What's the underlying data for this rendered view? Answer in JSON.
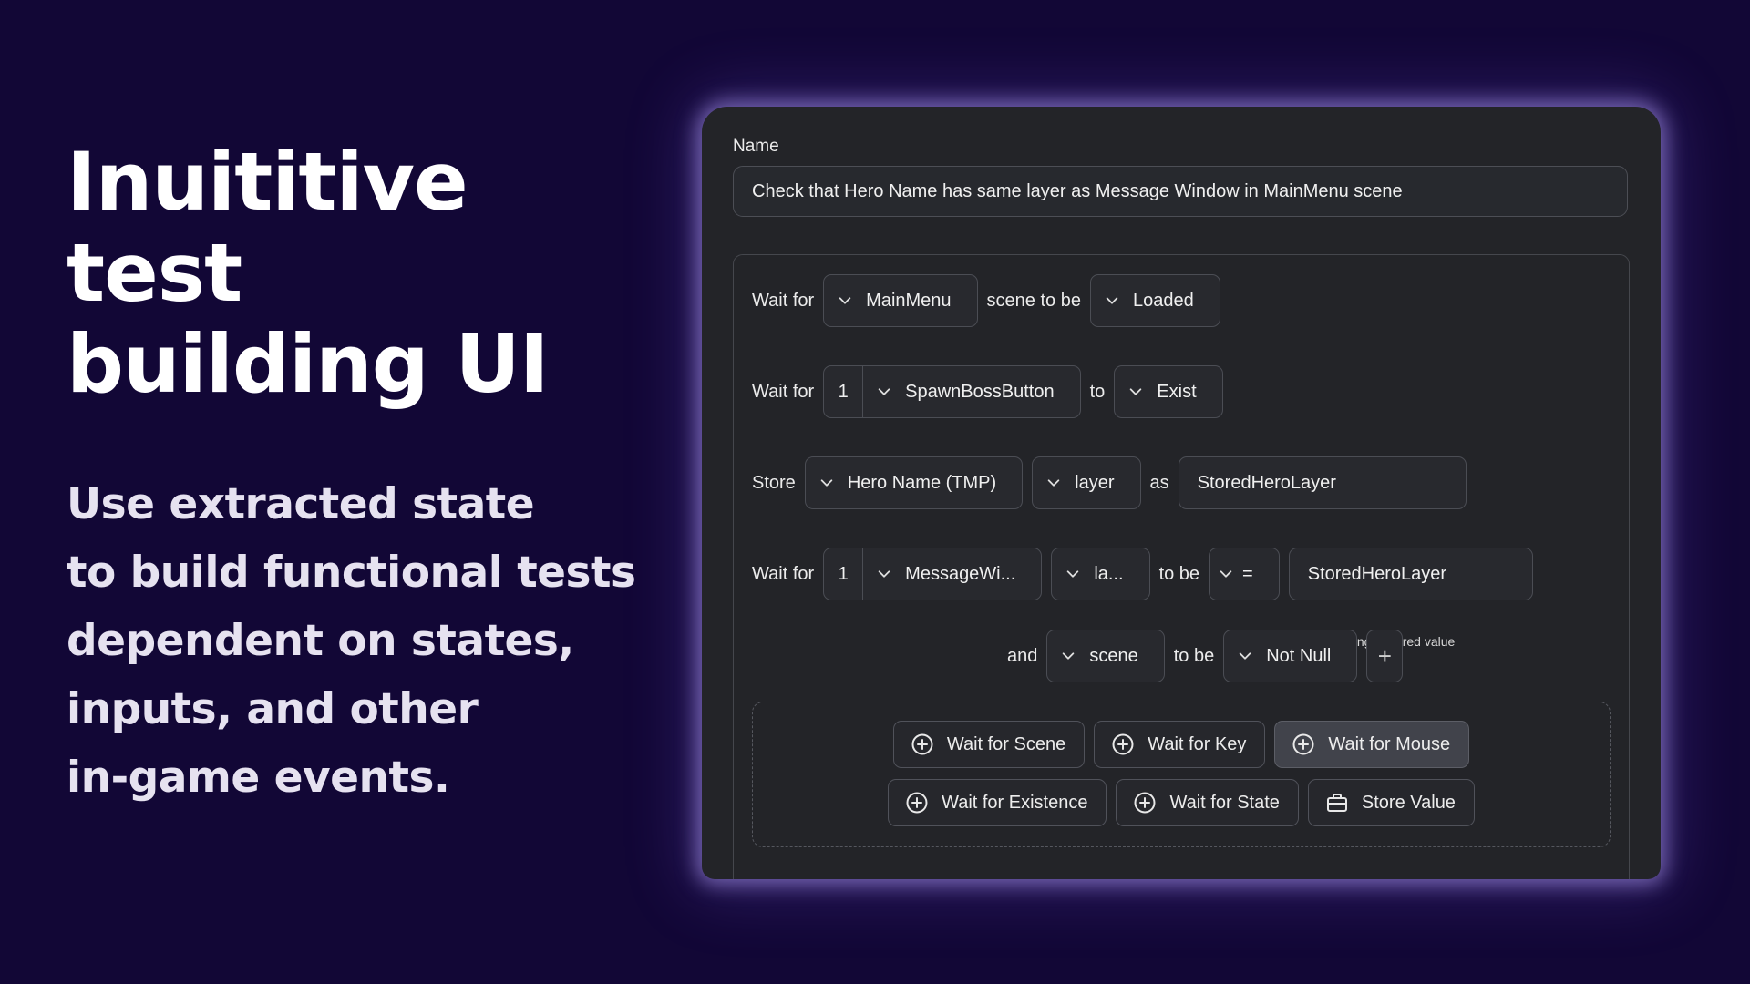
{
  "hero": {
    "title_line1": "Inuititive test",
    "title_line2": "building UI",
    "body_lines": [
      "Use extracted state",
      "to build functional tests",
      "dependent on states,",
      "inputs, and other",
      "in-game events."
    ]
  },
  "form": {
    "name_label": "Name",
    "name_value": "Check that Hero Name has same layer as Message Window in MainMenu scene"
  },
  "steps": {
    "row1": {
      "word1": "Wait for",
      "scene": "MainMenu",
      "word2": "scene to be",
      "state": "Loaded"
    },
    "row2": {
      "word1": "Wait for",
      "count": "1",
      "object": "SpawnBossButton",
      "word2": "to",
      "condition": "Exist"
    },
    "row3": {
      "word1": "Store",
      "object": "Hero Name (TMP)",
      "property": "layer",
      "word2": "as",
      "variable": "StoredHeroLayer"
    },
    "stored_note": "using a stored value",
    "row4": {
      "word1": "Wait for",
      "count": "1",
      "object": "MessageWi...",
      "property": "la...",
      "word2": "to be",
      "operator": "=",
      "value": "StoredHeroLayer"
    },
    "row5": {
      "word1": "and",
      "property": "scene",
      "word2": "to be",
      "value": "Not Null",
      "add_label": "+"
    }
  },
  "add_buttons": [
    {
      "label": "Wait for Scene",
      "icon": "plus-circle-icon"
    },
    {
      "label": "Wait for Key",
      "icon": "plus-circle-icon"
    },
    {
      "label": "Wait for Mouse",
      "icon": "plus-circle-icon",
      "active": true
    },
    {
      "label": "Wait for Existence",
      "icon": "plus-circle-icon"
    },
    {
      "label": "Wait for State",
      "icon": "plus-circle-icon"
    },
    {
      "label": "Store Value",
      "icon": "briefcase-icon"
    }
  ],
  "colors": {
    "background": "#120736",
    "panel": "#232428",
    "panel_glow": "#b8a4ff",
    "text": "#ebebeb"
  }
}
